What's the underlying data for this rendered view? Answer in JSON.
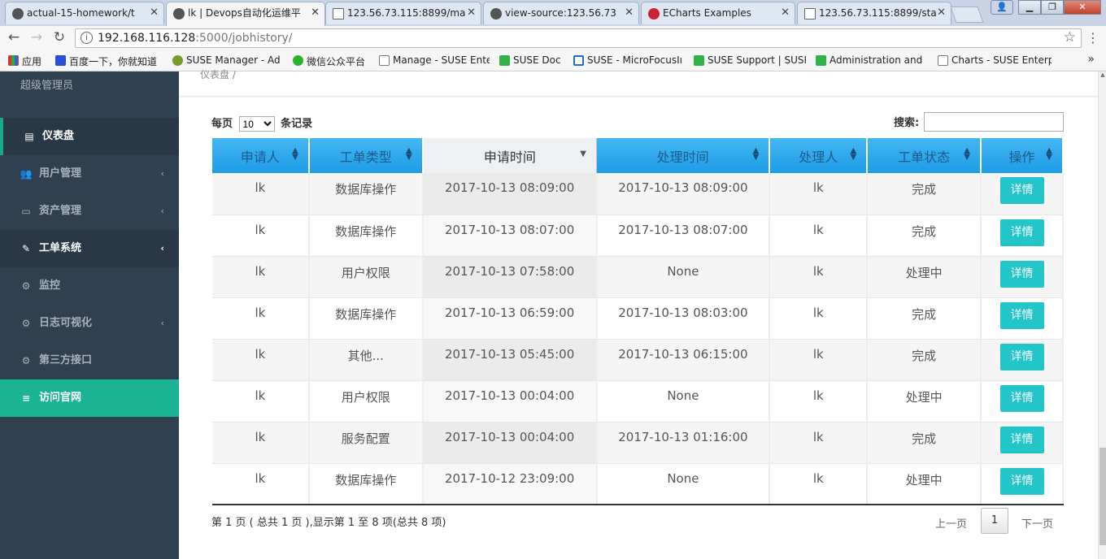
{
  "browser": {
    "tabs": [
      {
        "title": "actual-15-homework/t",
        "icon": "github-icon"
      },
      {
        "title": "lk | Devops自动化运维平",
        "icon": "site-icon"
      },
      {
        "title": "123.56.73.115:8899/ma",
        "icon": "page-icon"
      },
      {
        "title": "view-source:123.56.73",
        "icon": "site-icon"
      },
      {
        "title": "ECharts Examples",
        "icon": "echarts-icon"
      },
      {
        "title": "123.56.73.115:8899/sta",
        "icon": "page-icon"
      }
    ],
    "url_host": "192.168.116.128",
    "url_path": ":5000/jobhistory/",
    "bookmarks": [
      "应用",
      "百度一下，你就知道",
      "SUSE Manager - Adı",
      "微信公众平台",
      "Manage - SUSE Ente",
      "SUSE Doc",
      "SUSE - MicroFocusIı",
      "SUSE Support | SUSI",
      "Administration and",
      "Charts - SUSE Enterp"
    ]
  },
  "sidebar": {
    "user_role": "超级管理员",
    "items": [
      {
        "label": "仪表盘",
        "icon": "map-icon",
        "state": "active"
      },
      {
        "label": "用户管理",
        "icon": "users-icon",
        "chevron": "‹"
      },
      {
        "label": "资产管理",
        "icon": "hdd-icon",
        "chevron": "‹"
      },
      {
        "label": "工单系统",
        "icon": "edit-icon",
        "chevron": "‹",
        "state": "open"
      },
      {
        "label": "监控",
        "icon": "cogs-icon"
      },
      {
        "label": "日志可视化",
        "icon": "cogs-icon",
        "chevron": "‹"
      },
      {
        "label": "第三方接口",
        "icon": "cogs-icon"
      },
      {
        "label": "访问官网",
        "icon": "database-icon",
        "state": "teal"
      }
    ]
  },
  "breadcrumb": "仪表盘 /",
  "table": {
    "length_prefix": "每页",
    "length_value": "10",
    "length_suffix": "条记录",
    "search_label": "搜索:",
    "columns": [
      "申请人",
      "工单类型",
      "申请时间",
      "处理时间",
      "处理人",
      "工单状态",
      "操作"
    ],
    "rows": [
      {
        "applicant": "lk",
        "type": "数据库操作",
        "apply_time": "2017-10-13 08:09:00",
        "handle_time": "2017-10-13 08:09:00",
        "handler": "lk",
        "status": "完成",
        "action": "详情"
      },
      {
        "applicant": "lk",
        "type": "数据库操作",
        "apply_time": "2017-10-13 08:07:00",
        "handle_time": "2017-10-13 08:07:00",
        "handler": "lk",
        "status": "完成",
        "action": "详情"
      },
      {
        "applicant": "lk",
        "type": "用户权限",
        "apply_time": "2017-10-13 07:58:00",
        "handle_time": "None",
        "handler": "lk",
        "status": "处理中",
        "action": "详情"
      },
      {
        "applicant": "lk",
        "type": "数据库操作",
        "apply_time": "2017-10-13 06:59:00",
        "handle_time": "2017-10-13 08:03:00",
        "handler": "lk",
        "status": "完成",
        "action": "详情"
      },
      {
        "applicant": "lk",
        "type": "其他...",
        "apply_time": "2017-10-13 05:45:00",
        "handle_time": "2017-10-13 06:15:00",
        "handler": "lk",
        "status": "完成",
        "action": "详情"
      },
      {
        "applicant": "lk",
        "type": "用户权限",
        "apply_time": "2017-10-13 00:04:00",
        "handle_time": "None",
        "handler": "lk",
        "status": "处理中",
        "action": "详情"
      },
      {
        "applicant": "lk",
        "type": "服务配置",
        "apply_time": "2017-10-13 00:04:00",
        "handle_time": "2017-10-13 01:16:00",
        "handler": "lk",
        "status": "完成",
        "action": "详情"
      },
      {
        "applicant": "lk",
        "type": "数据库操作",
        "apply_time": "2017-10-12 23:09:00",
        "handle_time": "None",
        "handler": "lk",
        "status": "处理中",
        "action": "详情"
      }
    ],
    "info": "第 1 页 ( 总共 1 页 ),显示第 1 至 8 项(总共 8 项)",
    "pager": {
      "prev": "上一页",
      "current": "1",
      "next": "下一页"
    }
  },
  "colors": {
    "sidebar_bg": "#2f4050",
    "accent": "#1ab394",
    "header_blue": "#1d9ce8",
    "detail_button": "#23c6c8",
    "status_done": "#1414c8",
    "status_processing": "#e02020",
    "type_green": "#1f8b1f"
  }
}
